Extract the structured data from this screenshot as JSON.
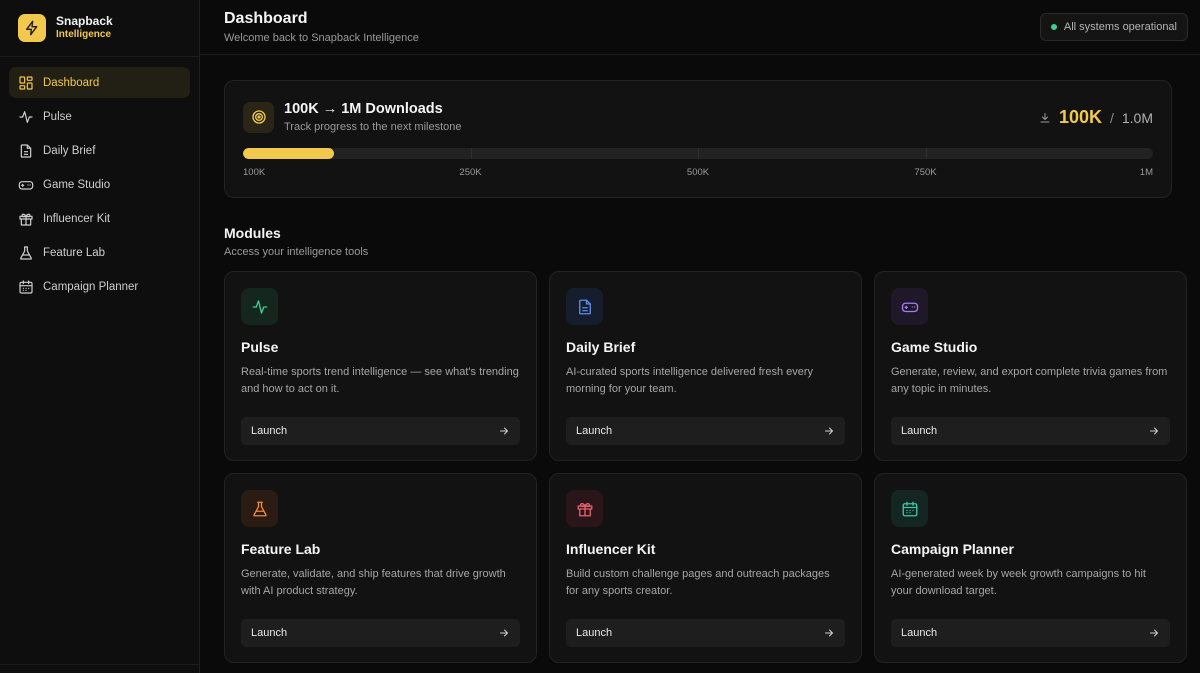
{
  "brand": {
    "name": "Snapback",
    "sub": "Intelligence",
    "accent": "#f2c94c"
  },
  "sidebar": {
    "items": [
      {
        "label": "Dashboard",
        "icon": "grid-icon",
        "active": true
      },
      {
        "label": "Pulse",
        "icon": "pulse-icon"
      },
      {
        "label": "Daily Brief",
        "icon": "document-icon"
      },
      {
        "label": "Game Studio",
        "icon": "gamepad-icon"
      },
      {
        "label": "Influencer Kit",
        "icon": "gift-icon"
      },
      {
        "label": "Feature Lab",
        "icon": "flask-icon"
      },
      {
        "label": "Campaign Planner",
        "icon": "calendar-icon"
      }
    ]
  },
  "header": {
    "title": "Dashboard",
    "subtitle": "Welcome back to Snapback Intelligence",
    "status": "All systems operational",
    "status_color": "#3ecf8e"
  },
  "milestone": {
    "title": "100K → 1M Downloads",
    "subtitle": "Track progress to the next milestone",
    "current": "100K",
    "separator": "/",
    "target": "1.0M",
    "progress_fraction": 0.1,
    "ticks": [
      "100K",
      "250K",
      "500K",
      "750K",
      "1M"
    ]
  },
  "modules": {
    "title": "Modules",
    "subtitle": "Access your intelligence tools",
    "launch_label": "Launch",
    "cards": [
      {
        "title": "Pulse",
        "desc": "Real-time sports trend intelligence — see what's trending and how to act on it.",
        "icon": "pulse-icon",
        "color": "#3ecf8e",
        "bg": "#14261d"
      },
      {
        "title": "Daily Brief",
        "desc": "AI-curated sports intelligence delivered fresh every morning for your team.",
        "icon": "document-icon",
        "color": "#5b8def",
        "bg": "#161d2c"
      },
      {
        "title": "Game Studio",
        "desc": "Generate, review, and export complete trivia games from any topic in minutes.",
        "icon": "gamepad-icon",
        "color": "#a77bf3",
        "bg": "#1f1829"
      },
      {
        "title": "Feature Lab",
        "desc": "Generate, validate, and ship features that drive growth with AI product strategy.",
        "icon": "flask-icon",
        "color": "#f0883e",
        "bg": "#2a1c12"
      },
      {
        "title": "Influencer Kit",
        "desc": "Build custom challenge pages and outreach packages for any sports creator.",
        "icon": "gift-icon",
        "color": "#e5616f",
        "bg": "#2a1619"
      },
      {
        "title": "Campaign Planner",
        "desc": "AI-generated week by week growth campaigns to hit your download target.",
        "icon": "calendar-icon",
        "color": "#3ec7a8",
        "bg": "#132622"
      }
    ]
  }
}
